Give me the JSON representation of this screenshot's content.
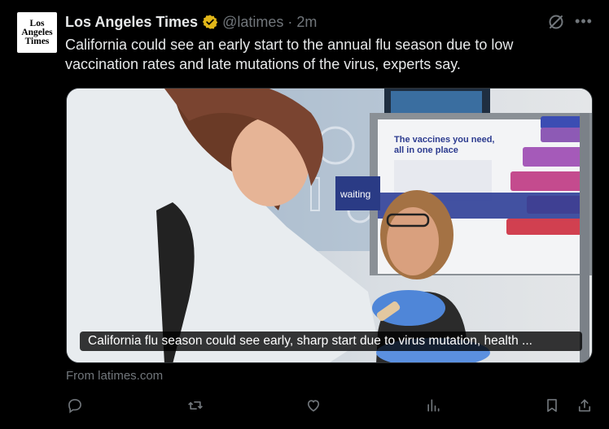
{
  "account": {
    "avatar_lines": [
      "Los",
      "Angeles",
      "Times"
    ],
    "name": "Los Angeles Times",
    "handle": "@latimes",
    "separator": "·",
    "time": "2m",
    "verified_color": "#e2b719"
  },
  "tweet": {
    "text": "California could see an early start to the annual flu season due to low vaccination rates and late mutations of the virus, experts say."
  },
  "card": {
    "caption": "California flu season could see early, sharp start due to virus mutation, health ...",
    "source": "From latimes.com",
    "poster_heading": "The vaccines you need, all in one place",
    "sign_text": "waiting"
  },
  "actions": [
    "reply-icon",
    "repost-icon",
    "like-icon",
    "views-icon",
    "bookmark-icon",
    "share-icon"
  ],
  "colors": {
    "background": "#000000",
    "text": "#e7e9ea",
    "muted": "#71767b"
  }
}
